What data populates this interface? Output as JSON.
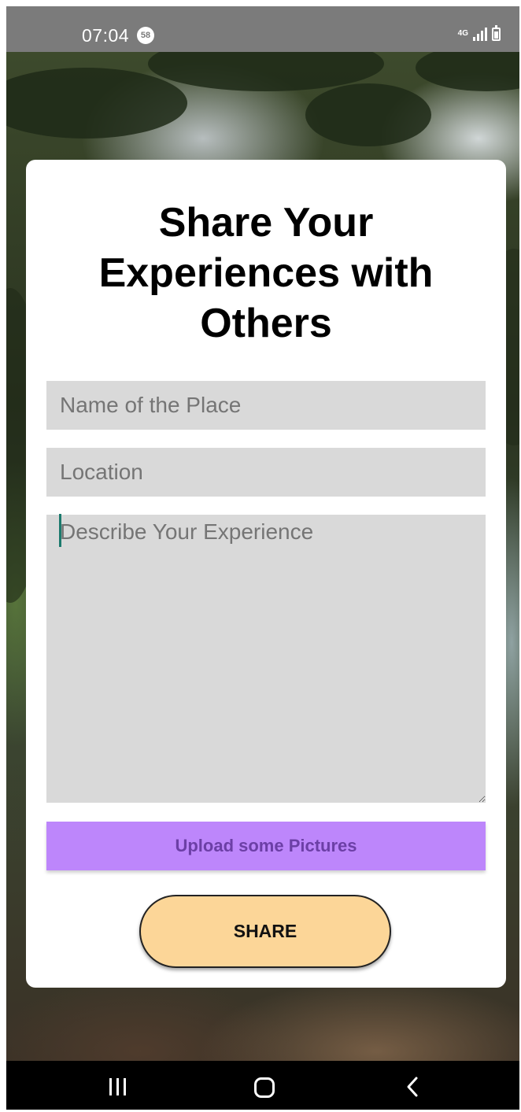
{
  "status_bar": {
    "time": "07:04",
    "notification_count": "58",
    "network_type": "4G"
  },
  "form": {
    "title": "Share Your Experiences with Others",
    "place_name_placeholder": "Name of the Place",
    "location_placeholder": "Location",
    "experience_placeholder": "Describe Your Experience",
    "upload_label": "Upload some Pictures",
    "share_label": "SHARE"
  },
  "colors": {
    "upload_button": "#bd86fb",
    "share_button": "#fcd698",
    "input_background": "#d9d9d9",
    "caret": "#1b7a6d"
  },
  "icons": {
    "signal": "signal-icon",
    "battery": "battery-charging-icon",
    "recents": "recents-icon",
    "home": "home-icon",
    "back": "back-icon"
  }
}
